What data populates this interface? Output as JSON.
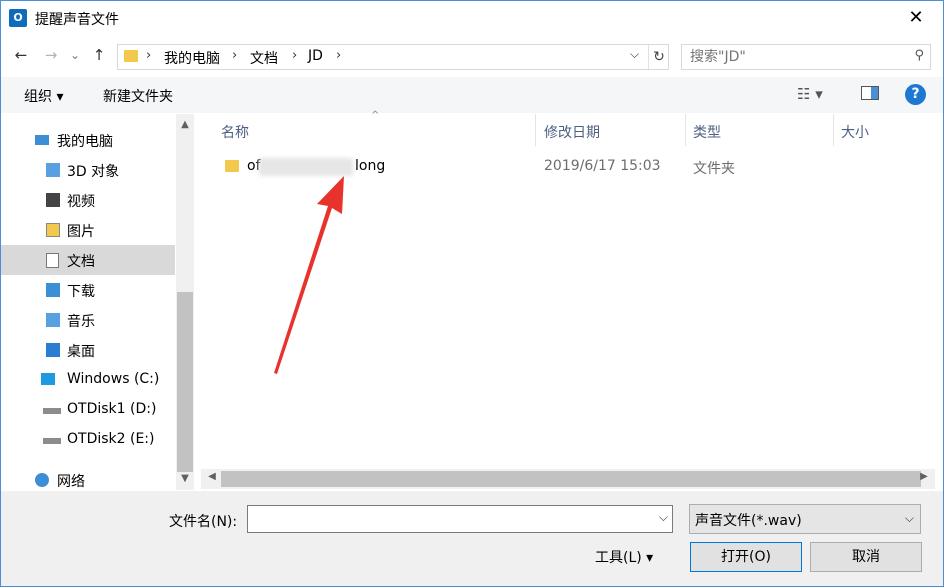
{
  "window": {
    "title": "提醒声音文件",
    "app_icon": "O",
    "close_glyph": "✕"
  },
  "nav": {
    "back": "←",
    "forward": "→",
    "recent": "⌄",
    "up": "↑",
    "breadcrumb": [
      "我的电脑",
      "文档",
      "JD"
    ],
    "separator": "›",
    "refresh": "↻",
    "search_placeholder": "搜索\"JD\""
  },
  "toolbar": {
    "organize": "组织 ▾",
    "new_folder": "新建文件夹",
    "view_icon": "view-list-icon",
    "help": "?"
  },
  "sidebar": {
    "items": [
      {
        "label": "我的电脑",
        "icon": "computer-icon"
      },
      {
        "label": "3D 对象",
        "icon": "3d-objects-icon"
      },
      {
        "label": "视频",
        "icon": "video-icon"
      },
      {
        "label": "图片",
        "icon": "pictures-icon"
      },
      {
        "label": "文档",
        "icon": "documents-icon",
        "selected": true
      },
      {
        "label": "下载",
        "icon": "downloads-icon"
      },
      {
        "label": "音乐",
        "icon": "music-icon"
      },
      {
        "label": "桌面",
        "icon": "desktop-icon"
      },
      {
        "label": "Windows (C:)",
        "icon": "windows-drive-icon"
      },
      {
        "label": "OTDisk1 (D:)",
        "icon": "drive-icon"
      },
      {
        "label": "OTDisk2 (E:)",
        "icon": "drive-icon"
      },
      {
        "label": "网络",
        "icon": "network-icon"
      }
    ]
  },
  "columns": {
    "name": "名称",
    "modified": "修改日期",
    "type": "类型",
    "size": "大小"
  },
  "files": [
    {
      "name_start": "of",
      "name_end": "long",
      "modified": "2019/6/17 15:03",
      "type": "文件夹",
      "size": ""
    }
  ],
  "bottom": {
    "filename_label": "文件名(N):",
    "filename_value": "",
    "file_type": "声音文件(*.wav)",
    "tools": "工具(L)  ▾",
    "open": "打开(O)",
    "cancel": "取消"
  },
  "colors": {
    "accent": "#0078d7",
    "arrow": "#e8332c"
  }
}
